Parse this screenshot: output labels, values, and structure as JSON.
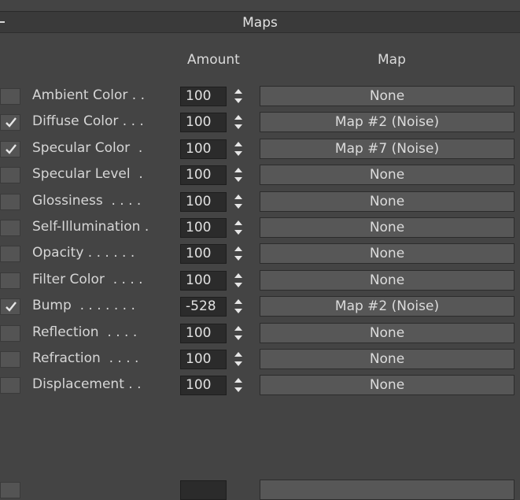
{
  "rollout": {
    "title": "Maps",
    "collapse_symbol": "-"
  },
  "columns": {
    "amount": "Amount",
    "map": "Map"
  },
  "rows": [
    {
      "checked": false,
      "label": "Ambient Color . .",
      "amount": "100",
      "map": "None"
    },
    {
      "checked": true,
      "label": "Diffuse Color . . .",
      "amount": "100",
      "map": "Map #2  (Noise)"
    },
    {
      "checked": true,
      "label": "Specular Color  .",
      "amount": "100",
      "map": "Map #7  (Noise)"
    },
    {
      "checked": false,
      "label": "Specular Level  .",
      "amount": "100",
      "map": "None"
    },
    {
      "checked": false,
      "label": "Glossiness  . . . .",
      "amount": "100",
      "map": "None"
    },
    {
      "checked": false,
      "label": "Self-Illumination .",
      "amount": "100",
      "map": "None"
    },
    {
      "checked": false,
      "label": "Opacity . . . . . .",
      "amount": "100",
      "map": "None"
    },
    {
      "checked": false,
      "label": "Filter Color  . . . .",
      "amount": "100",
      "map": "None"
    },
    {
      "checked": true,
      "label": "Bump  . . . . . . .",
      "amount": "-528",
      "map": "Map #2  (Noise)"
    },
    {
      "checked": false,
      "label": "Reflection  . . . .",
      "amount": "100",
      "map": "None"
    },
    {
      "checked": false,
      "label": "Refraction  . . . .",
      "amount": "100",
      "map": "None"
    },
    {
      "checked": false,
      "label": "Displacement . .",
      "amount": "100",
      "map": "None"
    }
  ],
  "icons": {
    "checkbox_check": "checkmark-icon",
    "spinner": "spinner-arrows-icon"
  },
  "colors": {
    "panel_bg": "#444444",
    "field_bg": "#2b2b2b",
    "button_bg": "#575757",
    "text": "#dcdcdc"
  }
}
